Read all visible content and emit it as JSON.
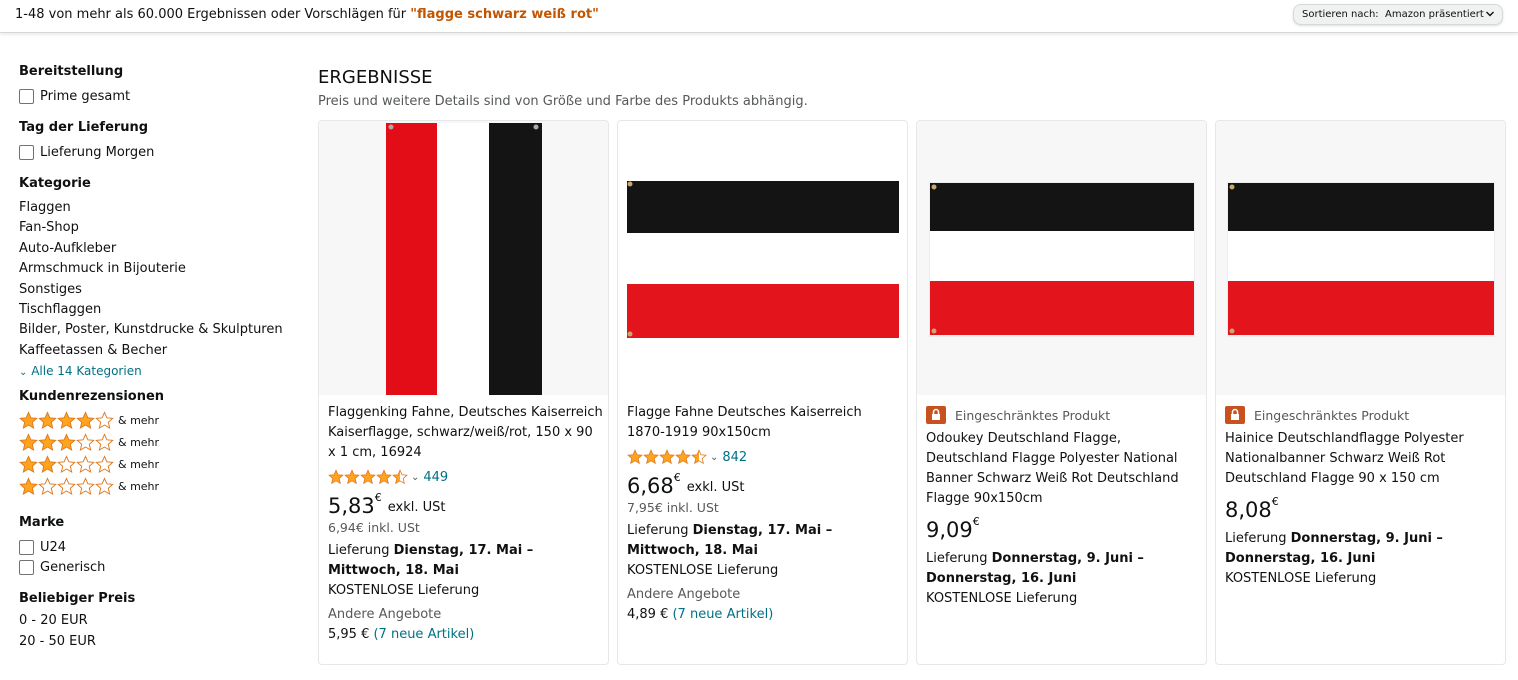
{
  "topbar": {
    "result_prefix": "1-48 von mehr als 60.000 Ergebnissen oder Vorschlägen für ",
    "query": "\"flagge schwarz weiß rot\"",
    "sort_label": "Sortieren nach:",
    "sort_value": "Amazon präsentiert",
    "sort_icon": "chevron-down-icon"
  },
  "sidebar": {
    "delivery_heading": "Bereitstellung",
    "prime_label": "Prime gesamt",
    "day_heading": "Tag der Lieferung",
    "tomorrow_label": "Lieferung Morgen",
    "category_heading": "Kategorie",
    "categories": [
      "Flaggen",
      "Fan-Shop",
      "Auto-Aufkleber",
      "Armschmuck in Bijouterie",
      "Sonstiges",
      "Tischflaggen",
      "Bilder, Poster, Kunstdrucke & Skulpturen",
      "Kaffeetassen & Becher"
    ],
    "all_categories": "Alle 14 Kategorien",
    "reviews_heading": "Kundenrezensionen",
    "review_filters": [
      {
        "stars": 4,
        "label": "& mehr"
      },
      {
        "stars": 3,
        "label": "& mehr"
      },
      {
        "stars": 2,
        "label": "& mehr"
      },
      {
        "stars": 1,
        "label": "& mehr"
      }
    ],
    "brand_heading": "Marke",
    "brands": [
      "U24",
      "Generisch"
    ],
    "price_heading": "Beliebiger Preis",
    "price_ranges": [
      "0 - 20 EUR",
      "20 - 50 EUR"
    ]
  },
  "main": {
    "heading": "ERGEBNISSE",
    "subheading": "Preis und weitere Details sind von Größe und Farbe des Produkts abhängig.",
    "products": [
      {
        "restricted": "",
        "title": "Flaggenking Fahne, Deutsches Kaiserreich Kaiserflagge, schwarz/weiß/rot, 150 x 90 x 1 cm, 16924",
        "rating": 4.5,
        "rating_count": "449",
        "price": "5,83",
        "currency": "€",
        "price_note": "exkl. USt",
        "price_incl": "6,94€ inkl. USt",
        "delivery_prefix": "Lieferung ",
        "delivery_date": "Dienstag, 17. Mai – Mittwoch, 18. Mai",
        "free_shipping": "KOSTENLOSE Lieferung",
        "other_offers": "Andere Angebote",
        "other_price": "5,95 € ",
        "other_link": "(7 neue Artikel)",
        "image_colors": [
          "#e30d18",
          "#ffffff",
          "#141414"
        ]
      },
      {
        "restricted": "",
        "title": "Flagge Fahne Deutsches Kaiserreich 1870-1919 90x150cm",
        "rating": 4.5,
        "rating_count": "842",
        "price": "6,68",
        "currency": "€",
        "price_note": "exkl. USt",
        "price_incl": "7,95€ inkl. USt",
        "delivery_prefix": "Lieferung ",
        "delivery_date": "Dienstag, 17. Mai – Mittwoch, 18. Mai",
        "free_shipping": "KOSTENLOSE Lieferung",
        "other_offers": "Andere Angebote",
        "other_price": "4,89 € ",
        "other_link": "(7 neue Artikel)",
        "image_colors": [
          "#141414",
          "#ffffff",
          "#e3141c"
        ]
      },
      {
        "restricted": "Eingeschränktes Produkt",
        "title": "Odoukey Deutschland Flagge, Deutschland Flagge Polyester National Banner Schwarz Weiß Rot Deutschland Flagge 90x150cm",
        "rating": 0,
        "rating_count": "",
        "price": "9,09",
        "currency": "€",
        "price_note": "",
        "price_incl": "",
        "delivery_prefix": "Lieferung ",
        "delivery_date": "Donnerstag, 9. Juni – Donnerstag, 16. Juni",
        "free_shipping": "KOSTENLOSE Lieferung",
        "other_offers": "",
        "other_price": "",
        "other_link": "",
        "image_colors": [
          "#141414",
          "#ffffff",
          "#e3141c"
        ]
      },
      {
        "restricted": "Eingeschränktes Produkt",
        "title": "Hainice Deutschlandflagge Polyester Nationalbanner Schwarz Weiß Rot Deutschland Flagge 90 x 150 cm",
        "rating": 0,
        "rating_count": "",
        "price": "8,08",
        "currency": "€",
        "price_note": "",
        "price_incl": "",
        "delivery_prefix": "Lieferung ",
        "delivery_date": "Donnerstag, 9. Juni – Donnerstag, 16. Juni",
        "free_shipping": "KOSTENLOSE Lieferung",
        "other_offers": "",
        "other_price": "",
        "other_link": "",
        "image_colors": [
          "#141414",
          "#ffffff",
          "#e3141c"
        ]
      }
    ]
  },
  "colors": {
    "accent_orange": "#c45500",
    "link_teal": "#007185",
    "star_orange": "#ffa41c",
    "restricted_badge": "#c7511f"
  }
}
